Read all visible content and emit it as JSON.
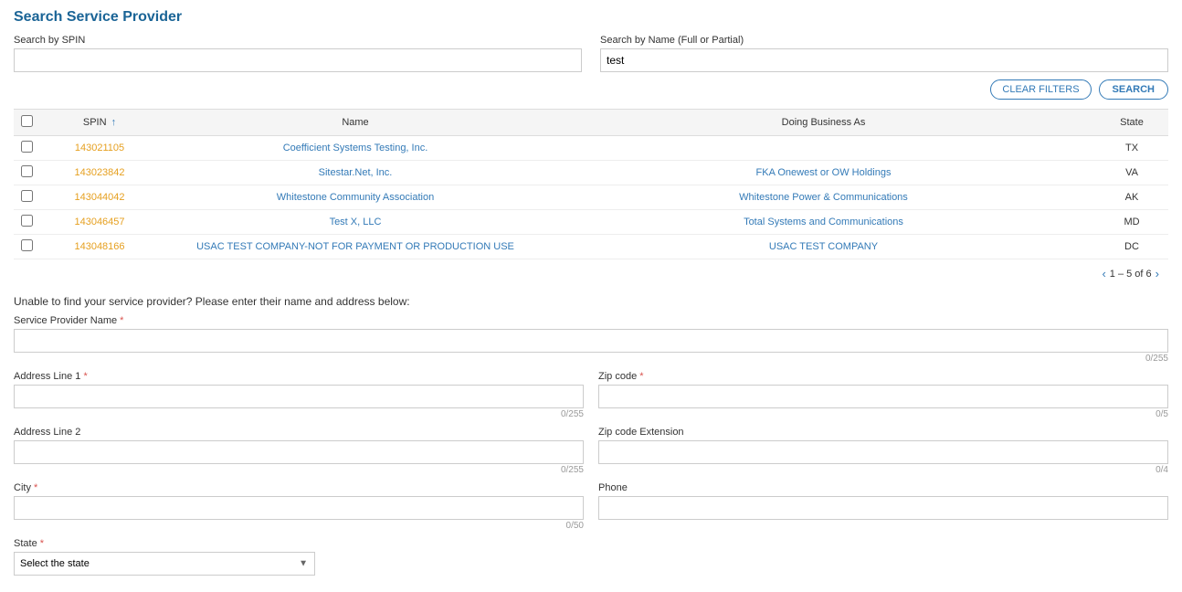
{
  "page": {
    "title": "Search Service Provider"
  },
  "search": {
    "spin_label": "Search by SPIN",
    "spin_value": "",
    "spin_placeholder": "",
    "name_label": "Search by Name (Full or Partial)",
    "name_value": "test",
    "name_placeholder": ""
  },
  "buttons": {
    "clear_filters": "CLEAR FILTERS",
    "search": "SEARCH"
  },
  "table": {
    "columns": [
      "SPIN",
      "Name",
      "Doing Business As",
      "State"
    ],
    "rows": [
      {
        "spin": "143021105",
        "name": "Coefficient Systems Testing, Inc.",
        "dba": "",
        "state": "TX"
      },
      {
        "spin": "143023842",
        "name": "Sitestar.Net, Inc.",
        "dba": "FKA Onewest or OW Holdings",
        "state": "VA"
      },
      {
        "spin": "143044042",
        "name": "Whitestone Community Association",
        "dba": "Whitestone Power & Communications",
        "state": "AK"
      },
      {
        "spin": "143046457",
        "name": "Test X, LLC",
        "dba": "Total Systems and Communications",
        "state": "MD"
      },
      {
        "spin": "143048166",
        "name": "USAC TEST COMPANY-NOT FOR PAYMENT OR PRODUCTION USE",
        "dba": "USAC TEST COMPANY",
        "state": "DC"
      }
    ],
    "pagination": "1 – 5 of 6"
  },
  "unable_section": {
    "text": "Unable to find your service provider? Please enter their name and address below:",
    "fields": {
      "provider_name_label": "Service Provider Name",
      "provider_name_max": "0/255",
      "address1_label": "Address Line 1",
      "address1_max": "0/255",
      "address2_label": "Address Line 2",
      "address2_max": "0/255",
      "city_label": "City",
      "city_max": "0/50",
      "state_label": "State",
      "state_placeholder": "Select the state",
      "zipcode_label": "Zip code",
      "zipcode_max": "0/5",
      "zipcode_ext_label": "Zip code Extension",
      "zipcode_ext_max": "0/4",
      "phone_label": "Phone"
    }
  }
}
